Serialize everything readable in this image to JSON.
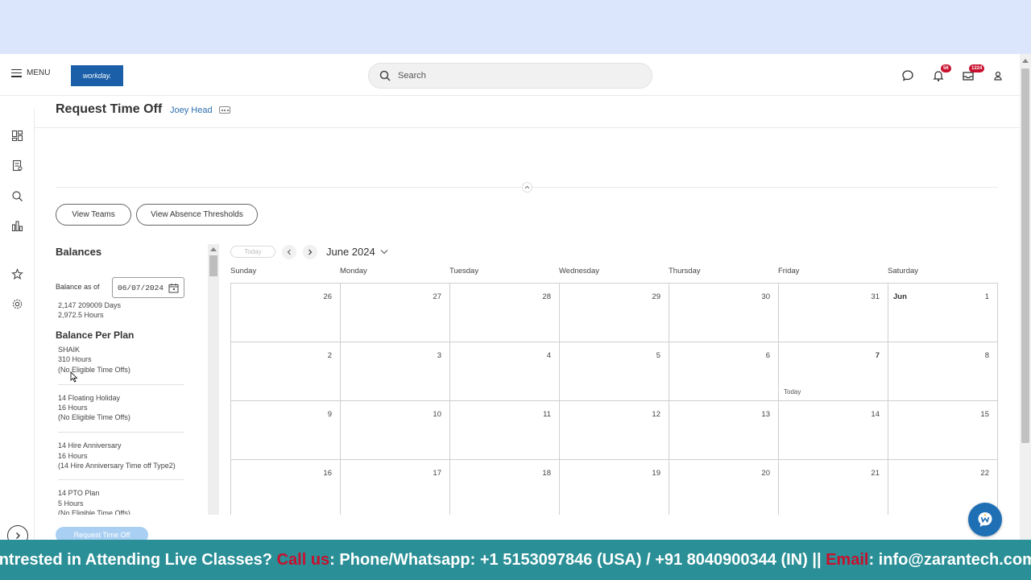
{
  "header": {
    "menu_label": "MENU",
    "logo_text": "workday.",
    "search_placeholder": "Search",
    "notifications_count": "56",
    "inbox_count": "1224"
  },
  "page": {
    "title": "Request Time Off",
    "worker": "Joey Head"
  },
  "buttons": {
    "view_teams": "View Teams",
    "view_absence_thresholds": "View Absence Thresholds",
    "request_time_off": "Request Time Off"
  },
  "balances": {
    "title": "Balances",
    "as_of_label": "Balance as of",
    "as_of_date": "06/07/2024",
    "days": "2,147 209009 Days",
    "hours": "2,972.5 Hours",
    "per_plan_title": "Balance Per Plan",
    "plans": [
      {
        "name": "SHAIK",
        "hours": "310 Hours",
        "note": "(No Eligible Time Offs)"
      },
      {
        "name": "14 Floating Holiday",
        "hours": "16 Hours",
        "note": "(No Eligible Time Offs)"
      },
      {
        "name": "14 Hire Anniversary",
        "hours": "16 Hours",
        "note": "(14 Hire Anniversary Time off Type2)"
      },
      {
        "name": "14 PTO Plan",
        "hours": "5 Hours",
        "note": "(No Eligible Time Offs)"
      }
    ]
  },
  "calendar": {
    "today_button": "Today",
    "month": "June 2024",
    "days_of_week": [
      "Sunday",
      "Monday",
      "Tuesday",
      "Wednesday",
      "Thursday",
      "Friday",
      "Saturday"
    ],
    "weeks": [
      [
        "26",
        "27",
        "28",
        "29",
        "30",
        "31",
        "1"
      ],
      [
        "2",
        "3",
        "4",
        "5",
        "6",
        "7",
        "8"
      ],
      [
        "9",
        "10",
        "11",
        "12",
        "13",
        "14",
        "15"
      ],
      [
        "16",
        "17",
        "18",
        "19",
        "20",
        "21",
        "22"
      ]
    ],
    "month_marker": "Jun",
    "today_label": "Today"
  },
  "banner": {
    "part1": "Intrested in Attending Live Classes? ",
    "call_us": "Call us",
    "part2": ": Phone/Whatsapp: +1 5153097846 (USA) / +91 8040900344 (IN) || ",
    "email_label": "Email",
    "part3": ": info@zarantech.com"
  },
  "colors": {
    "accent_blue": "#2f6fb0",
    "badge_red": "#c8102e",
    "banner_teal": "#2a8f96",
    "top_band": "#dbe5fb"
  },
  "icons": [
    "hamburger-icon",
    "search-icon",
    "chat-icon",
    "bell-icon",
    "inbox-icon",
    "user-icon",
    "dashboard-icon",
    "report-icon",
    "search-report-icon",
    "chart-icon",
    "star-icon",
    "gear-icon",
    "calendar-icon",
    "chevron-left-icon",
    "chevron-right-icon",
    "chevron-down-icon",
    "chevron-up-icon",
    "assistant-icon"
  ]
}
